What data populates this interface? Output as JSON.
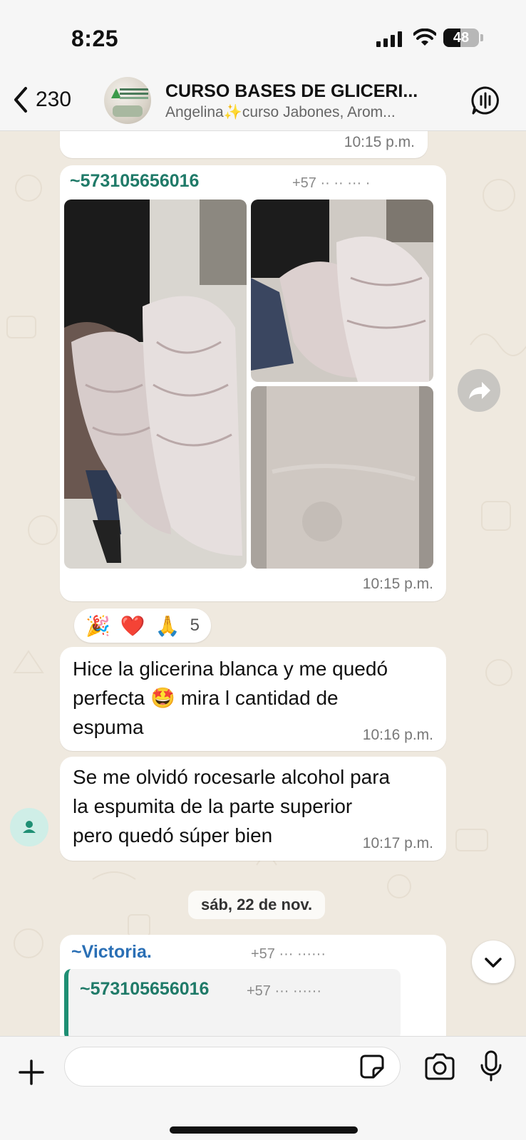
{
  "status_bar": {
    "time": "8:25",
    "battery": "48",
    "battery_level": 0.48
  },
  "header": {
    "back_count": "230",
    "title": "CURSO BASES DE GLICERI...",
    "subtitle": "Angelina✨curso Jabones, Arom..."
  },
  "messages": {
    "first_time": "10:15 p.m.",
    "album": {
      "sender": "~573105656016",
      "sender_phone": "+57 ·· ·· ··· ·",
      "time": "10:15 p.m."
    },
    "reactions": {
      "emojis": [
        "🎉",
        "❤️",
        "🙏"
      ],
      "count": "5"
    },
    "text1": {
      "lines": [
        "Hice la glicerina blanca y me quedó",
        "perfecta 🤩 mira l cantidad de",
        "espuma"
      ],
      "time": "10:16 p.m."
    },
    "text2": {
      "lines": [
        "Se me olvidó rocesarle alcohol para",
        "la espumita de la parte superior",
        "pero quedó súper bien"
      ],
      "time": "10:17 p.m."
    },
    "date_separator": "sáb, 22 de nov.",
    "next": {
      "sender": "~Victoria.",
      "sender_phone": "+57 ··· ······",
      "quoted_sender": "~573105656016",
      "quoted_phone": "+57 ··· ······"
    }
  },
  "composer": {
    "placeholder": ""
  },
  "icons": {
    "back": "chevron-left-icon",
    "voice_chat": "voice-chat-icon",
    "forward": "forward-icon",
    "scroll": "chevron-down-icon",
    "plus": "plus-icon",
    "sticker": "sticker-icon",
    "camera": "camera-icon",
    "mic": "microphone-icon"
  },
  "colors": {
    "sender": "#1f7a68",
    "bubble": "#ffffff",
    "chat_bg": "#efe9df"
  }
}
